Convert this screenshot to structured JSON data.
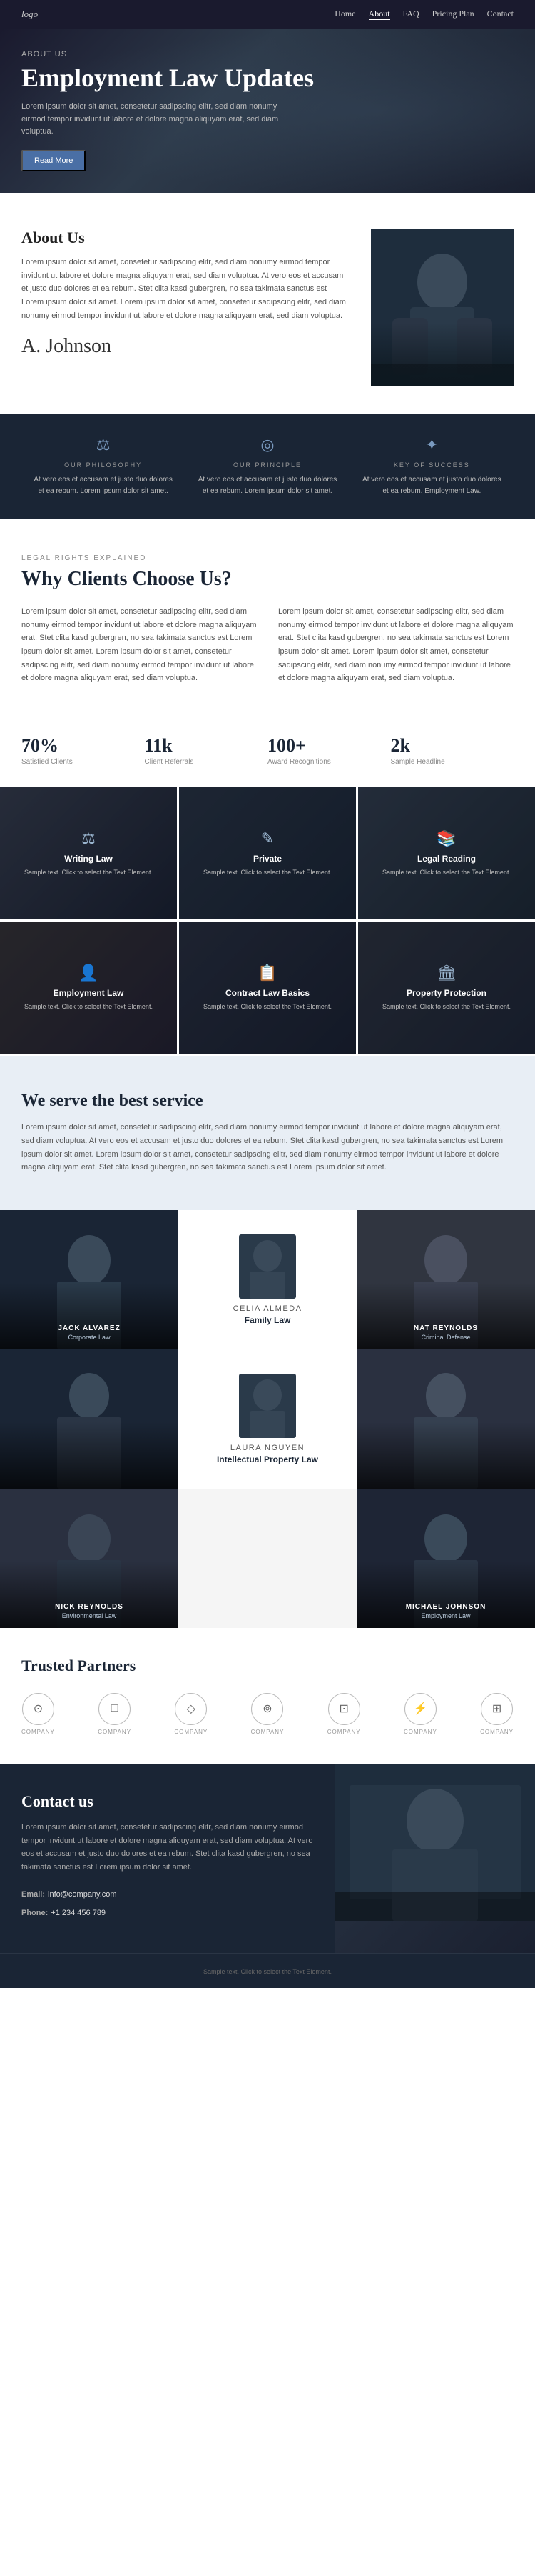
{
  "nav": {
    "logo": "logo",
    "links": [
      "Home",
      "About",
      "FAQ",
      "Pricing Plan",
      "Contact"
    ],
    "active": "About"
  },
  "hero": {
    "about_label": "ABOUT US",
    "title": "Employment Law Updates",
    "text": "Lorem ipsum dolor sit amet, consetetur sadipscing elitr, sed diam nonumy eirmod tempor invidunt ut labore et dolore magna aliquyam erat, sed diam voluptua.",
    "btn_label": "Read More"
  },
  "about": {
    "heading": "About Us",
    "body": "Lorem ipsum dolor sit amet, consetetur sadipscing elitr, sed diam nonumy eirmod tempor invidunt ut labore et dolore magna aliquyam erat, sed diam voluptua. At vero eos et accusam et justo duo dolores et ea rebum. Stet clita kasd gubergren, no sea takimata sanctus est Lorem ipsum dolor sit amet. Lorem ipsum dolor sit amet, consetetur sadipscing elitr, sed diam nonumy eirmod tempor invidunt ut labore et dolore magna aliquyam erat, sed diam voluptua.",
    "signature": "A. Johnson"
  },
  "philosophy": {
    "items": [
      {
        "icon": "⚖",
        "label": "OUR PHILOSOPHY",
        "text": "At vero eos et accusam et justo duo dolores et ea rebum. Lorem ipsum dolor sit amet."
      },
      {
        "icon": "◎",
        "label": "OUR PRINCIPLE",
        "text": "At vero eos et accusam et justo duo dolores et ea rebum. Lorem ipsum dolor sit amet."
      },
      {
        "icon": "✦",
        "label": "KEY OF SUCCESS",
        "text": "At vero eos et accusam et justo duo dolores et ea rebum. Employment Law."
      }
    ]
  },
  "why": {
    "label": "LEGAL RIGHTS EXPLAINED",
    "heading": "Why Clients Choose Us?",
    "col1": "Lorem ipsum dolor sit amet, consetetur sadipscing elitr, sed diam nonumy eirmod tempor invidunt ut labore et dolore magna aliquyam erat. Stet clita kasd gubergren, no sea takimata sanctus est Lorem ipsum dolor sit amet. Lorem ipsum dolor sit amet, consetetur sadipscing elitr, sed diam nonumy eirmod tempor invidunt ut labore et dolore magna aliquyam erat, sed diam voluptua.",
    "col2": "Lorem ipsum dolor sit amet, consetetur sadipscing elitr, sed diam nonumy eirmod tempor invidunt ut labore et dolore magna aliquyam erat. Stet clita kasd gubergren, no sea takimata sanctus est Lorem ipsum dolor sit amet. Lorem ipsum dolor sit amet, consetetur sadipscing elitr, sed diam nonumy eirmod tempor invidunt ut labore et dolore magna aliquyam erat, sed diam voluptua."
  },
  "stats": [
    {
      "number": "70%",
      "label": "Satisfied Clients"
    },
    {
      "number": "11k",
      "label": "Client Referrals"
    },
    {
      "number": "100+",
      "label": "Award Recognitions"
    },
    {
      "number": "2k",
      "label": "Sample Headline"
    }
  ],
  "services": [
    {
      "icon": "⚖",
      "title": "Writing Law",
      "sample": "Sample text. Click to select the Text Element."
    },
    {
      "icon": "✎",
      "title": "Private",
      "sample": "Sample text. Click to select the Text Element."
    },
    {
      "icon": "📚",
      "title": "Legal Reading",
      "sample": "Sample text. Click to select the Text Element."
    },
    {
      "icon": "👤",
      "title": "Employment Law",
      "sample": "Sample text. Click to select the Text Element."
    },
    {
      "icon": "📋",
      "title": "Contract Law Basics",
      "sample": "Sample text. Click to select the Text Element."
    },
    {
      "icon": "🏛",
      "title": "Property Protection",
      "sample": "Sample text. Click to select the Text Element."
    }
  ],
  "best_service": {
    "heading": "We serve the best service",
    "text": "Lorem ipsum dolor sit amet, consetetur sadipscing elitr, sed diam nonumy eirmod tempor invidunt ut labore et dolore magna aliquyam erat, sed diam voluptua. At vero eos et accusam et justo duo dolores et ea rebum. Stet clita kasd gubergren, no sea takimata sanctus est Lorem ipsum dolor sit amet. Lorem ipsum dolor sit amet, consetetur sadipscing elitr, sed diam nonumy eirmod tempor invidunt ut labore et dolore magna aliquyam erat. Stet clita kasd gubergren, no sea takimata sanctus est Lorem ipsum dolor sit amet."
  },
  "team": {
    "members": [
      {
        "name": "CELIA ALMEDA",
        "role": "Family Law",
        "bg": "t1",
        "position": "center"
      },
      {
        "name": "JACK ALVAREZ",
        "role": "Corporate Law",
        "bg": "t2",
        "position": "left"
      },
      {
        "name": "NAT REYNOLDS",
        "role": "Criminal Defense",
        "bg": "t3",
        "position": "right"
      },
      {
        "name": "LAURA NGUYEN",
        "role": "Intellectual Property Law",
        "bg": "t4",
        "position": "center"
      },
      {
        "name": "NICK REYNOLDS",
        "role": "Environmental Law",
        "bg": "t5",
        "position": "left"
      },
      {
        "name": "MICHAEL JOHNSON",
        "role": "Employment Law",
        "bg": "t6",
        "position": "right"
      }
    ]
  },
  "partners": {
    "heading": "Trusted Partners",
    "items": [
      {
        "icon": "⊙",
        "label": "COMPANY"
      },
      {
        "icon": "□",
        "label": "COMPANY"
      },
      {
        "icon": "◇",
        "label": "COMPANY"
      },
      {
        "icon": "⊚",
        "label": "COMPANY"
      },
      {
        "icon": "⊡",
        "label": "COMPANY"
      },
      {
        "icon": "⚡",
        "label": "COMPANY"
      },
      {
        "icon": "⊞",
        "label": "COMPANY"
      }
    ]
  },
  "contact": {
    "heading": "Contact us",
    "body": "Lorem ipsum dolor sit amet, consetetur sadipscing elitr, sed diam nonumy eirmod tempor invidunt ut labore et dolore magna aliquyam erat, sed diam voluptua. At vero eos et accusam et justo duo dolores et ea rebum. Stet clita kasd gubergren, no sea takimata sanctus est Lorem ipsum dolor sit amet.",
    "email_label": "Email:",
    "email_value": "info@company.com",
    "phone_label": "Phone:",
    "phone_value": "+1 234 456 789"
  },
  "footer": {
    "sample": "Sample text. Click to select the Text Element."
  }
}
